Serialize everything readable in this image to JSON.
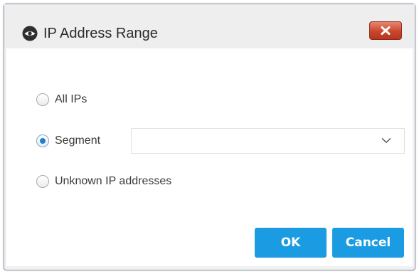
{
  "dialog": {
    "title": "IP Address Range",
    "title_icon": "eye-shield-icon",
    "close_icon": "close-icon"
  },
  "options": [
    {
      "label": "All IPs",
      "selected": false
    },
    {
      "label": "Segment",
      "selected": true
    },
    {
      "label": "Unknown IP addresses",
      "selected": false
    }
  ],
  "segment_select": {
    "value": "",
    "icon": "chevron-down-icon"
  },
  "buttons": {
    "ok": "OK",
    "cancel": "Cancel"
  },
  "colors": {
    "accent": "#1b9ce2",
    "close_red": "#c9462e",
    "radio_selected": "#1e7fd3"
  }
}
